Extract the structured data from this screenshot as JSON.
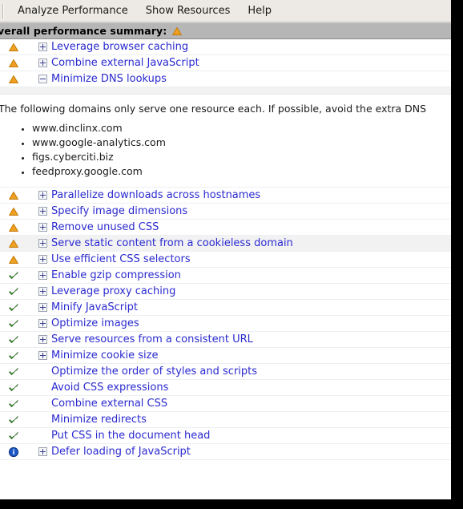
{
  "toolbar": {
    "menus": [
      {
        "label": "Analyze Performance",
        "name": "menu-analyze-performance"
      },
      {
        "label": "Show Resources",
        "name": "menu-show-resources"
      },
      {
        "label": "Help",
        "name": "menu-help"
      }
    ]
  },
  "summary": {
    "label": "verall performance summary:",
    "status_icon": "warning-icon"
  },
  "colors": {
    "warning": "#f0a020",
    "ok": "#3a8a2e",
    "info": "#1a57c8",
    "link": "#2a2ad0",
    "header_bar": "#b6b6b6",
    "toolbar": "#edeae5",
    "row_highlight": "#f2f2f2"
  },
  "rules": [
    {
      "status": "warning",
      "expander": "plus",
      "label": "Leverage browser caching"
    },
    {
      "status": "warning",
      "expander": "plus",
      "label": "Combine external JavaScript"
    },
    {
      "status": "warning",
      "expander": "minus",
      "label": "Minimize DNS lookups",
      "expanded": true
    },
    {
      "status": "warning",
      "expander": "plus",
      "label": "Parallelize downloads across hostnames"
    },
    {
      "status": "warning",
      "expander": "plus",
      "label": "Specify image dimensions"
    },
    {
      "status": "warning",
      "expander": "plus",
      "label": "Remove unused CSS"
    },
    {
      "status": "warning",
      "expander": "plus",
      "label": "Serve static content from a cookieless domain",
      "highlight": true
    },
    {
      "status": "warning",
      "expander": "plus",
      "label": "Use efficient CSS selectors"
    },
    {
      "status": "ok",
      "expander": "plus",
      "label": "Enable gzip compression"
    },
    {
      "status": "ok",
      "expander": "plus",
      "label": "Leverage proxy caching"
    },
    {
      "status": "ok",
      "expander": "plus",
      "label": "Minify JavaScript"
    },
    {
      "status": "ok",
      "expander": "plus",
      "label": "Optimize images"
    },
    {
      "status": "ok",
      "expander": "plus",
      "label": "Serve resources from a consistent URL"
    },
    {
      "status": "ok",
      "expander": "plus",
      "label": "Minimize cookie size"
    },
    {
      "status": "ok",
      "expander": "none",
      "label": "Optimize the order of styles and scripts"
    },
    {
      "status": "ok",
      "expander": "none",
      "label": "Avoid CSS expressions"
    },
    {
      "status": "ok",
      "expander": "none",
      "label": "Combine external CSS"
    },
    {
      "status": "ok",
      "expander": "none",
      "label": "Minimize redirects"
    },
    {
      "status": "ok",
      "expander": "none",
      "label": "Put CSS in the document head"
    },
    {
      "status": "info",
      "expander": "plus",
      "label": "Defer loading of JavaScript"
    }
  ],
  "dns_detail": {
    "text": "The following domains only serve one resource each. If possible, avoid the extra DNS",
    "domains": [
      "www.dinclinx.com",
      "www.google-analytics.com",
      "figs.cyberciti.biz",
      "feedproxy.google.com"
    ]
  }
}
